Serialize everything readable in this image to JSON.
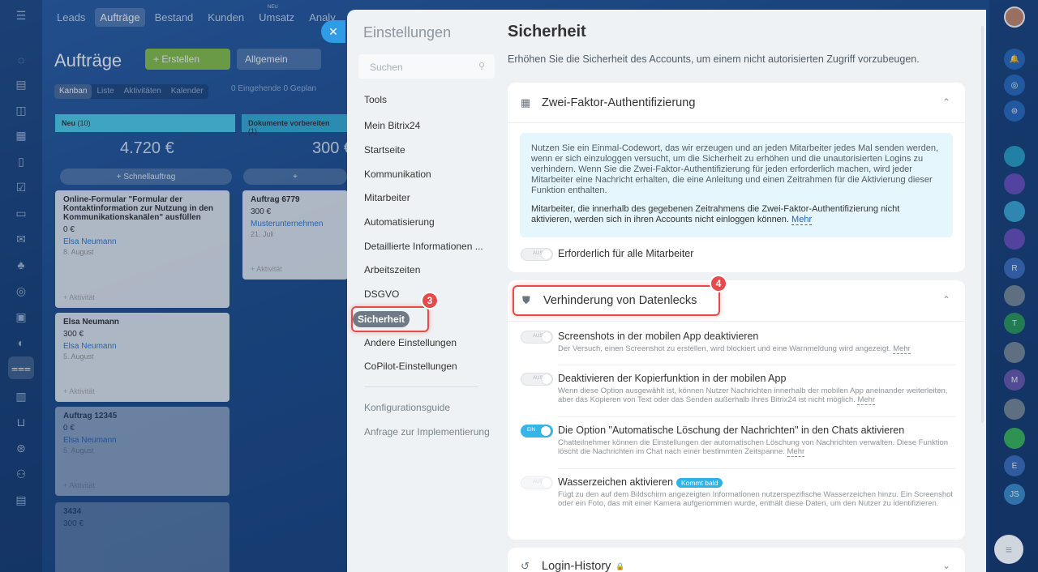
{
  "topnav": [
    "Leads",
    "Aufträge",
    "Bestand",
    "Kunden",
    "Umsatz",
    "Analy"
  ],
  "topnav_badge": "NEU",
  "kanban": {
    "title": "Aufträge",
    "create": "+ Erstellen",
    "filter": "Allgemein",
    "views": [
      "Kanban",
      "Liste",
      "Aktivitäten",
      "Kalender"
    ],
    "counters": [
      {
        "count": "0",
        "label": "Eingehende"
      },
      {
        "count": "0",
        "label": "Geplan"
      }
    ],
    "stages": [
      {
        "name": "Neu",
        "count": "(10)",
        "sum": "4.720 €"
      },
      {
        "name": "Dokumente vorbereiten",
        "count": "(1)",
        "sum": "300 €"
      }
    ],
    "quick": "+ Schnellauftrag",
    "cards": [
      {
        "title": "Online-Formular \"Formular der Kontaktinformation zur Nutzung in den Kommunikationskanälen\" ausfüllen",
        "value": "0 €",
        "person": "Elsa Neumann",
        "date": "8. August",
        "activity": "+ Aktivität",
        "adate": "8. Aug"
      },
      {
        "title": "Elsa Neumann",
        "value": "300 €",
        "person": "Elsa Neumann",
        "date": "5. August",
        "activity": "+ Aktivität",
        "adate": "5. Aug"
      },
      {
        "title": "Auftrag 12345",
        "value": "0 €",
        "person": "Elsa Neumann",
        "date": "5. August",
        "activity": "+ Aktivität",
        "adate": "5. Aug"
      },
      {
        "title": "3434",
        "value": "300 €",
        "person": "",
        "date": "",
        "activity": "",
        "adate": ""
      },
      {
        "title": "Auftrag 6779",
        "value": "300 €",
        "person": "Musterunternehmen",
        "date": "21. Juli",
        "activity": "+ Aktivität",
        "adate": ""
      }
    ]
  },
  "settings": {
    "title": "Einstellungen",
    "search_placeholder": "Suchen",
    "menu": [
      "Tools",
      "Mein Bitrix24",
      "Startseite",
      "Kommunikation",
      "Mitarbeiter",
      "Automatisierung",
      "Detaillierte Informationen ...",
      "Arbeitszeiten",
      "DSGVO",
      "Sicherheit",
      "Andere Einstellungen",
      "CoPilot-Einstellungen"
    ],
    "menu_extra": [
      "Konfigurationsguide",
      "Anfrage zur Implementierung"
    ]
  },
  "page": {
    "title": "Sicherheit",
    "subtitle": "Erhöhen Sie die Sicherheit des Accounts, um einem nicht autorisierten Zugriff vorzubeugen.",
    "two_factor": {
      "title": "Zwei-Faktor-Authentifizierung",
      "info1": "Nutzen Sie ein Einmal-Codewort, das wir erzeugen und an jeden Mitarbeiter jedes Mal senden werden, wenn er sich einzuloggen versucht, um die Sicherheit zu erhöhen und die unautorisierten Logins zu verhindern. Wenn Sie die Zwei-Faktor-Authentifizierung für jeden erforderlich machen, wird jeder Mitarbeiter eine Nachricht erhalten, die eine Anleitung und einen Zeitrahmen für die Aktivierung dieser Funktion enthalten.",
      "info2": "Mitarbeiter, die innerhalb des gegebenen Zeitrahmens die Zwei-Faktor-Authentifizierung nicht aktivieren, werden sich in ihren Accounts nicht einloggen können.",
      "more": "Mehr",
      "toggle_label": "AUS",
      "option": "Erforderlich für alle Mitarbeiter"
    },
    "leak": {
      "title": "Verhinderung von Datenlecks",
      "options": [
        {
          "title": "Screenshots in der mobilen App deaktivieren",
          "desc": "Der Versuch, einen Screenshot zu erstellen, wird blockiert und eine Warnmeldung wird angezeigt.",
          "more": "Mehr",
          "state": "AUS"
        },
        {
          "title": "Deaktivieren der Kopierfunktion in der mobilen App",
          "desc": "Wenn diese Option ausgewählt ist, können Nutzer Nachrichten innerhalb der mobilen App aneinander weiterleiten, aber das Kopieren von Text oder das Senden außerhalb Ihres Bitrix24 ist nicht möglich.",
          "more": "Mehr",
          "state": "AUS"
        },
        {
          "title": "Die Option \"Automatische Löschung der Nachrichten\" in den Chats aktivieren",
          "desc": "Chatteilnehmer können die Einstellungen der automatischen Löschung von Nachrichten verwalten. Diese Funktion löscht die Nachrichten im Chat nach einer bestimmten Zeitspanne.",
          "more": "Mehr",
          "state": "EIN"
        },
        {
          "title": "Wasserzeichen aktivieren",
          "badge": "Kommt bald",
          "desc": "Fügt zu den auf dem Bildschirm angezeigten Informationen nutzerspezifische Wasserzeichen hinzu. Ein Screenshot oder ein Foto, das mit einer Kamera aufgenommen wurde, enthält diese Daten, um den Nutzer zu identifizieren.",
          "more": "",
          "state": "AUS"
        }
      ]
    },
    "login_history": {
      "title": "Login-History"
    }
  },
  "markers": [
    "3",
    "4"
  ],
  "colors": {
    "accent": "#2f9ce5",
    "marker": "#e64b4b",
    "toggle_on": "#35b5e8",
    "info_bg": "#e5f6fc"
  }
}
